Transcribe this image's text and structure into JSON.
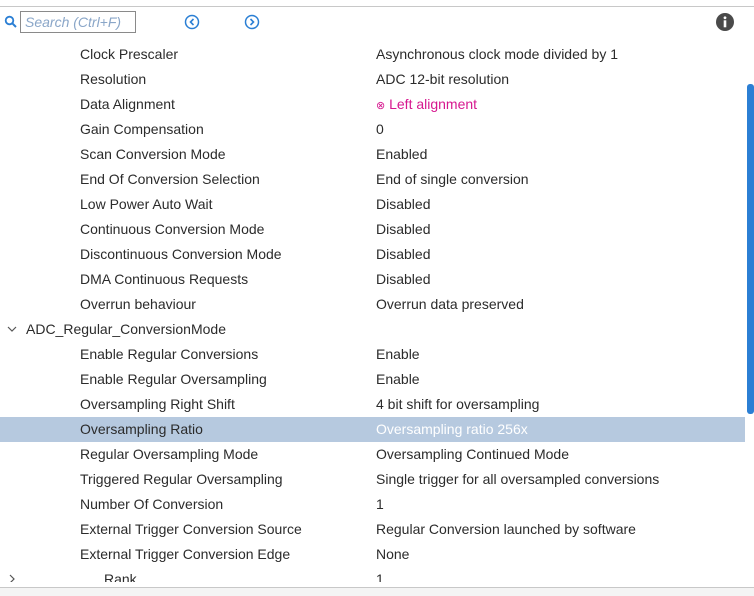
{
  "toolbar": {
    "search_placeholder": "Search (Ctrl+F)",
    "search_value": "",
    "accent": "#2b7fd4"
  },
  "rows_before": [
    {
      "name": "Clock Prescaler",
      "value": "Asynchronous clock mode divided by 1"
    },
    {
      "name": "Resolution",
      "value": "ADC 12-bit resolution"
    },
    {
      "name": "Data Alignment",
      "value": "Left alignment",
      "warning": true
    },
    {
      "name": "Gain Compensation",
      "value": "0"
    },
    {
      "name": "Scan Conversion Mode",
      "value": "Enabled"
    },
    {
      "name": "End Of Conversion Selection",
      "value": "End of single conversion"
    },
    {
      "name": "Low Power Auto Wait",
      "value": "Disabled"
    },
    {
      "name": "Continuous Conversion Mode",
      "value": "Disabled"
    },
    {
      "name": "Discontinuous Conversion Mode",
      "value": "Disabled"
    },
    {
      "name": "DMA Continuous Requests",
      "value": "Disabled"
    },
    {
      "name": "Overrun behaviour",
      "value": "Overrun data preserved"
    }
  ],
  "group": {
    "label": "ADC_Regular_ConversionMode",
    "expanded": true
  },
  "rows_group": [
    {
      "name": "Enable Regular Conversions",
      "value": "Enable"
    },
    {
      "name": "Enable Regular Oversampling",
      "value": "Enable"
    },
    {
      "name": "Oversampling Right Shift",
      "value": "4 bit shift for oversampling"
    },
    {
      "name": "Oversampling Ratio",
      "value": "Oversampling ratio 256x",
      "selected": true
    },
    {
      "name": "Regular Oversampling Mode",
      "value": "Oversampling Continued Mode"
    },
    {
      "name": "Triggered Regular Oversampling",
      "value": "Single trigger for all oversampled conversions"
    },
    {
      "name": "Number Of Conversion",
      "value": "1"
    },
    {
      "name": "External Trigger Conversion Source",
      "value": "Regular Conversion launched by software"
    },
    {
      "name": "External Trigger Conversion Edge",
      "value": "None"
    }
  ],
  "rank_row": {
    "name": "Rank",
    "value": "1"
  },
  "colors": {
    "selection": "#b6c9df",
    "warning": "#d6188f",
    "text": "#2b2b2b"
  }
}
